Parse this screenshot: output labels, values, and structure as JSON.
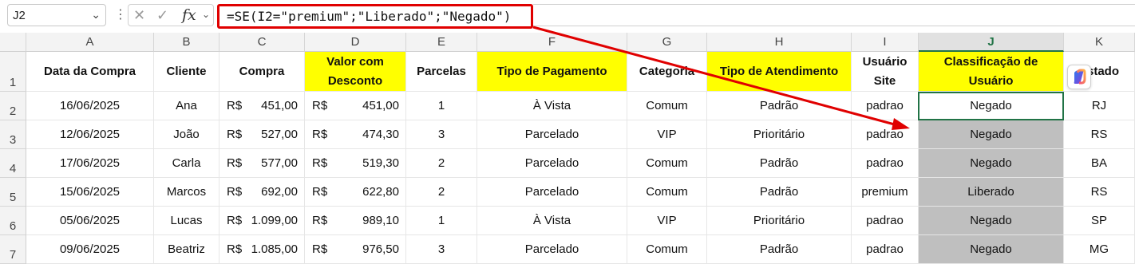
{
  "name_box": {
    "value": "J2",
    "dropdown_icon": "chevron-down-icon"
  },
  "formula_bar": {
    "menu_icon": "vertical-ellipsis-icon",
    "cancel_icon": "x-icon",
    "enter_icon": "checkmark-icon",
    "fx_label": "fx",
    "formula": "=SE(I2=\"premium\";\"Liberado\";\"Negado\")"
  },
  "columns": [
    "A",
    "B",
    "C",
    "D",
    "E",
    "F",
    "G",
    "H",
    "I",
    "J",
    "K"
  ],
  "selected_column": "J",
  "row_numbers": [
    "1",
    "2",
    "3",
    "4",
    "5",
    "6",
    "7"
  ],
  "headers": {
    "a": "Data da Compra",
    "b": "Cliente",
    "c": "Compra",
    "d": "Valor com Desconto",
    "e": "Parcelas",
    "f": "Tipo de Pagamento",
    "g": "Categoria",
    "h": "Tipo de Atendimento",
    "i": "Usuário Site",
    "j": "Classificação de Usuário",
    "k": "Estado"
  },
  "currency_symbol": "R$",
  "rows": [
    {
      "date": "16/06/2025",
      "client": "Ana",
      "compra": "451,00",
      "valor": "451,00",
      "parcelas": "1",
      "pagamento": "À Vista",
      "categoria": "Comum",
      "atendimento": "Padrão",
      "usuario": "padrao",
      "classificacao": "Negado",
      "estado": "RJ"
    },
    {
      "date": "12/06/2025",
      "client": "João",
      "compra": "527,00",
      "valor": "474,30",
      "parcelas": "3",
      "pagamento": "Parcelado",
      "categoria": "VIP",
      "atendimento": "Prioritário",
      "usuario": "padrao",
      "classificacao": "Negado",
      "estado": "RS"
    },
    {
      "date": "17/06/2025",
      "client": "Carla",
      "compra": "577,00",
      "valor": "519,30",
      "parcelas": "2",
      "pagamento": "Parcelado",
      "categoria": "Comum",
      "atendimento": "Padrão",
      "usuario": "padrao",
      "classificacao": "Negado",
      "estado": "BA"
    },
    {
      "date": "15/06/2025",
      "client": "Marcos",
      "compra": "692,00",
      "valor": "622,80",
      "parcelas": "2",
      "pagamento": "Parcelado",
      "categoria": "Comum",
      "atendimento": "Padrão",
      "usuario": "premium",
      "classificacao": "Liberado",
      "estado": "RS"
    },
    {
      "date": "05/06/2025",
      "client": "Lucas",
      "compra": "1.099,00",
      "valor": "989,10",
      "parcelas": "1",
      "pagamento": "À Vista",
      "categoria": "VIP",
      "atendimento": "Prioritário",
      "usuario": "padrao",
      "classificacao": "Negado",
      "estado": "SP"
    },
    {
      "date": "09/06/2025",
      "client": "Beatriz",
      "compra": "1.085,00",
      "valor": "976,50",
      "parcelas": "3",
      "pagamento": "Parcelado",
      "categoria": "Comum",
      "atendimento": "Padrão",
      "usuario": "padrao",
      "classificacao": "Negado",
      "estado": "MG"
    }
  ],
  "colors": {
    "highlight": "#ffff00",
    "classification_fill": "#bfbfbf",
    "annotation": "#e00000",
    "selection": "#217346"
  },
  "copilot_icon": "copilot-icon"
}
